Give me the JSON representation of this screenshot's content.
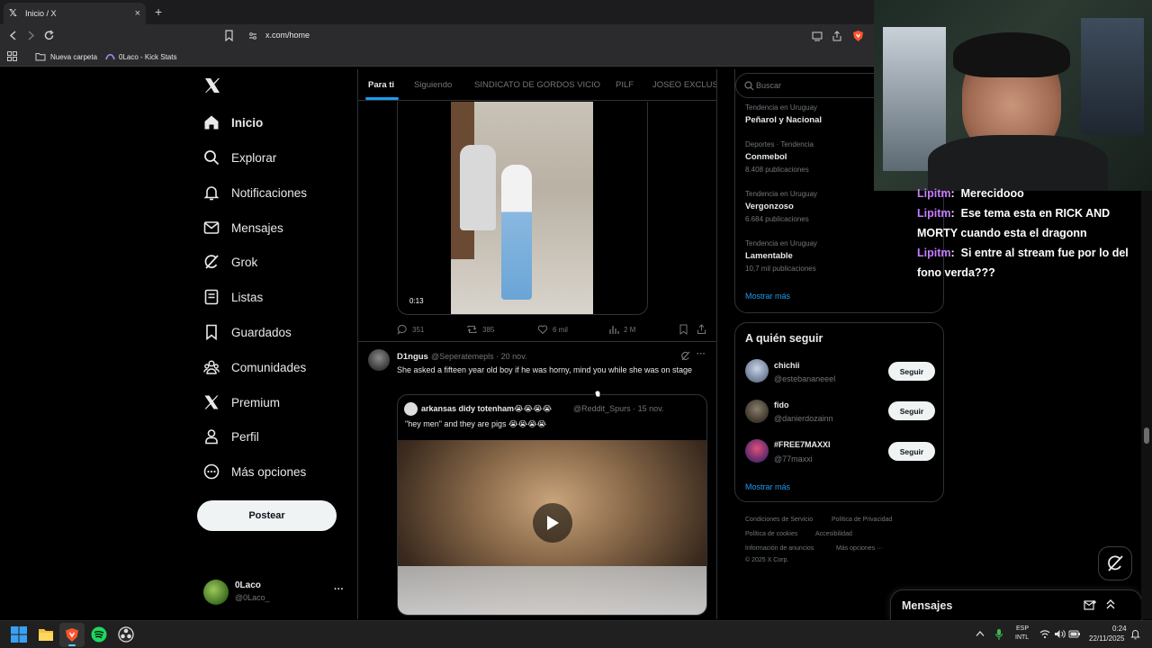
{
  "browser": {
    "tab_title": "Inicio / X",
    "tab_close": "×",
    "new_tab": "+",
    "url": "x.com/home",
    "bookmarks": [
      "Nueva carpeta",
      "0Laco - Kick Stats"
    ]
  },
  "nav": {
    "items": [
      {
        "label": "Inicio",
        "icon": "home-icon"
      },
      {
        "label": "Explorar",
        "icon": "search-icon"
      },
      {
        "label": "Notificaciones",
        "icon": "bell-icon"
      },
      {
        "label": "Mensajes",
        "icon": "mail-icon"
      },
      {
        "label": "Grok",
        "icon": "grok-icon"
      },
      {
        "label": "Listas",
        "icon": "list-icon"
      },
      {
        "label": "Guardados",
        "icon": "bookmark-icon"
      },
      {
        "label": "Comunidades",
        "icon": "communities-icon"
      },
      {
        "label": "Premium",
        "icon": "x-logo-icon"
      },
      {
        "label": "Perfil",
        "icon": "person-icon"
      },
      {
        "label": "Más opciones",
        "icon": "more-circle-icon"
      }
    ],
    "post_button": "Postear",
    "account": {
      "name": "0Laco",
      "handle": "@0Laco_",
      "more": "···"
    }
  },
  "timeline": {
    "tabs": [
      "Para ti",
      "Siguiendo",
      "SINDICATO DE GORDOS VICIO",
      "PILF",
      "JOSEO EXCLUSIV"
    ],
    "post1": {
      "video_time": "0:13",
      "replies": "351",
      "reposts": "385",
      "likes": "6 mil",
      "views": "2 M"
    },
    "post2": {
      "author": "D1ngus",
      "handle_date": "@Seperatemepls · 20 nov.",
      "more": "···",
      "text": "She asked a fifteen year old boy if he was horny, mind you while she was on stage",
      "quote": {
        "author": "arkansas didy totenham😭😭😭😭",
        "handle_date": "@Reddit_Spurs · 15 nov.",
        "text": "\"hey men\" and they are pigs 😭😭😭😭"
      }
    }
  },
  "right": {
    "search_placeholder": "Buscar",
    "trends": [
      {
        "meta": "Tendencia en Uruguay",
        "name": "Peñarol y Nacional",
        "count": ""
      },
      {
        "meta": "Deportes · Tendencia",
        "name": "Conmebol",
        "count": "8.408 publicaciones"
      },
      {
        "meta": "Tendencia en Uruguay",
        "name": "Vergonzoso",
        "count": "6.684 publicaciones"
      },
      {
        "meta": "Tendencia en Uruguay",
        "name": "Lamentable",
        "count": "10,7 mil publicaciones"
      }
    ],
    "show_more": "Mostrar más",
    "who_to_follow": {
      "title": "A quién seguir",
      "users": [
        {
          "name": "chichii",
          "handle": "@estebananeeel",
          "button": "Seguir"
        },
        {
          "name": "fido",
          "handle": "@danierdozainn",
          "button": "Seguir"
        },
        {
          "name": "#FREE7MAXXI",
          "handle": "@77maxxi",
          "button": "Seguir"
        }
      ],
      "show_more": "Mostrar más"
    },
    "footer": {
      "links": [
        "Condiciones de Servicio",
        "Política de Privacidad",
        "Política de cookies",
        "Accesibilidad",
        "Información de anuncios",
        "Más opciones ···"
      ],
      "copyright": "© 2025 X Corp."
    },
    "messages_label": "Mensajes"
  },
  "chat": {
    "lines": [
      {
        "user": "Lipitm",
        "text": "Merecidooo"
      },
      {
        "user": "Lipitm",
        "text": "Ese tema esta en RICK AND MORTY cuando esta el dragonn"
      },
      {
        "user": "Lipitm",
        "text": "Si entre al stream fue por lo del fono verda???"
      }
    ]
  },
  "taskbar": {
    "lang": "ESP",
    "lang2": "INTL",
    "time": "0:24",
    "date": "22/11/2025"
  },
  "colors": {
    "accent": "#1d9bf0",
    "chat_user": "#c77dff",
    "background": "#000000"
  }
}
